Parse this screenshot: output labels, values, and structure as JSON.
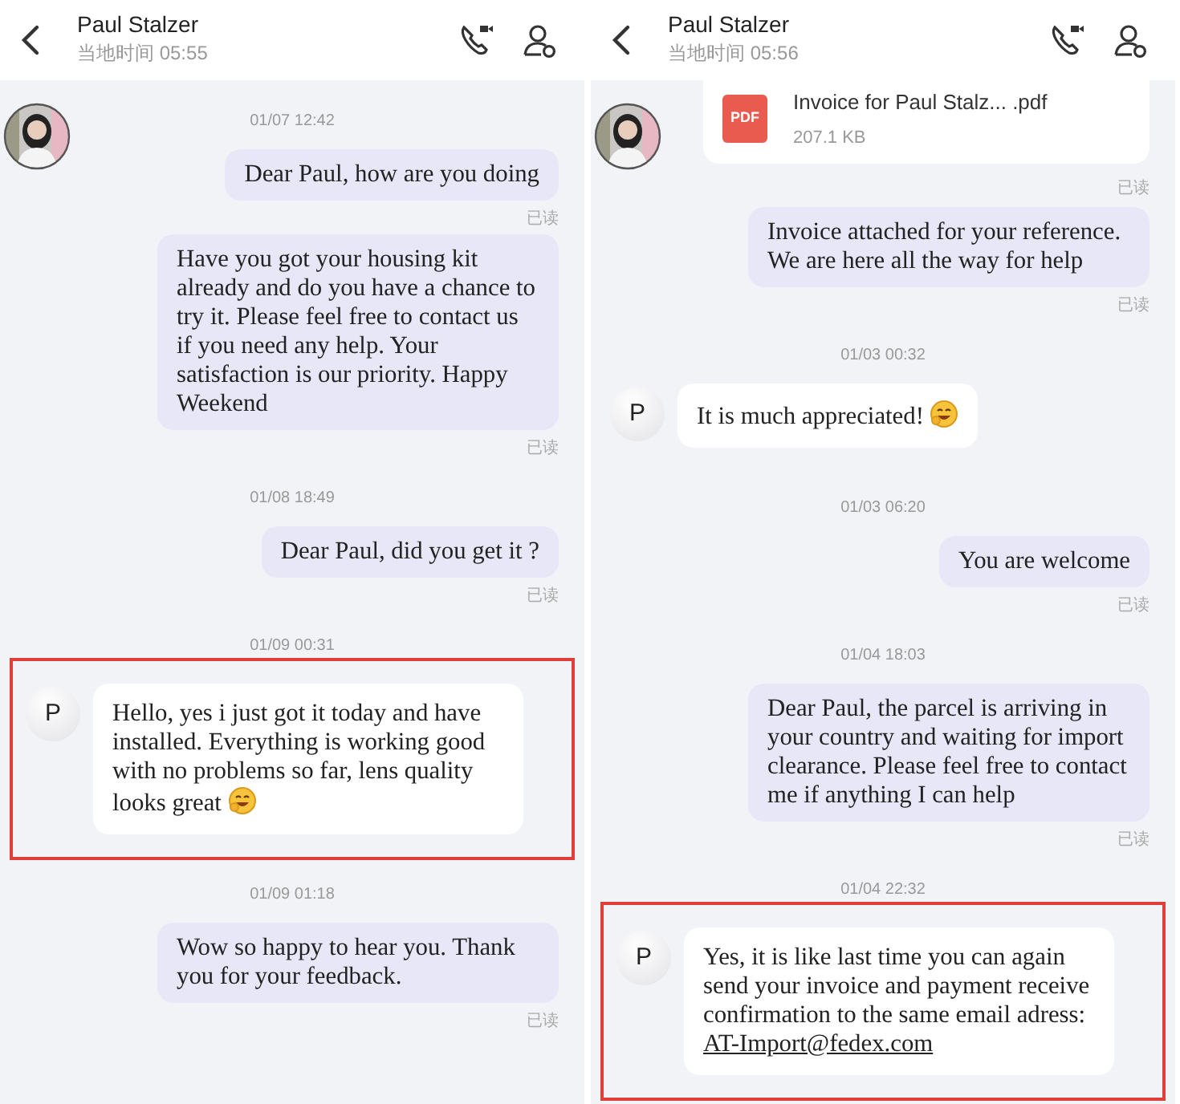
{
  "panels": [
    {
      "header": {
        "name": "Paul Stalzer",
        "local_time": "当地时间 05:55"
      },
      "has_avatar": true,
      "items": [
        {
          "kind": "time",
          "text": "01/07 12:42"
        },
        {
          "kind": "outgoing",
          "text": "Dear Paul, how are you doing",
          "status": "已读"
        },
        {
          "kind": "outgoing",
          "text": "Have you got your housing kit already and do you have a chance to try it.  Please feel free to contact us if you need any help. Your satisfaction is our priority. Happy Weekend",
          "status": "已读"
        },
        {
          "kind": "time",
          "text": "01/08 18:49"
        },
        {
          "kind": "outgoing",
          "text": "Dear Paul, did you get it ?",
          "status": "已读"
        },
        {
          "kind": "time",
          "text": "01/09 00:31"
        },
        {
          "kind": "incoming",
          "avatar": "P",
          "text": "Hello, yes i just got it today and have installed. Everything is working good with no problems so far, lens quality looks great",
          "emoji": true,
          "highlighted": true
        },
        {
          "kind": "time",
          "text": "01/09 01:18"
        },
        {
          "kind": "outgoing",
          "text": "Wow so happy to hear you. Thank you for your feedback.",
          "status": "已读"
        }
      ]
    },
    {
      "header": {
        "name": "Paul Stalzer",
        "local_time": "当地时间 05:56"
      },
      "has_avatar": true,
      "items": [
        {
          "kind": "file",
          "name": "Invoice for Paul Stalz... .pdf",
          "size": "207.1 KB",
          "file_type": "PDF",
          "status": "已读"
        },
        {
          "kind": "outgoing",
          "text": "Invoice attached for your reference. We are here all the way for help",
          "status": "已读"
        },
        {
          "kind": "time",
          "text": "01/03 00:32"
        },
        {
          "kind": "incoming",
          "avatar": "P",
          "text": "It is much appreciated!",
          "emoji": true,
          "highlighted": false
        },
        {
          "kind": "time",
          "text": "01/03 06:20"
        },
        {
          "kind": "outgoing",
          "text": "You are welcome",
          "status": "已读"
        },
        {
          "kind": "time",
          "text": "01/04 18:03"
        },
        {
          "kind": "outgoing",
          "text": "Dear Paul, the parcel is arriving in your country and waiting for import clearance. Please feel free to contact me if anything I can help",
          "status": "已读"
        },
        {
          "kind": "time",
          "text": "01/04 22:32"
        },
        {
          "kind": "incoming",
          "avatar": "P",
          "text": "Yes, it is like last time you can again send your invoice and payment receive confirmation to the same email adress:",
          "link": "AT-Import@fedex.com",
          "emoji": false,
          "highlighted": true
        }
      ]
    }
  ]
}
